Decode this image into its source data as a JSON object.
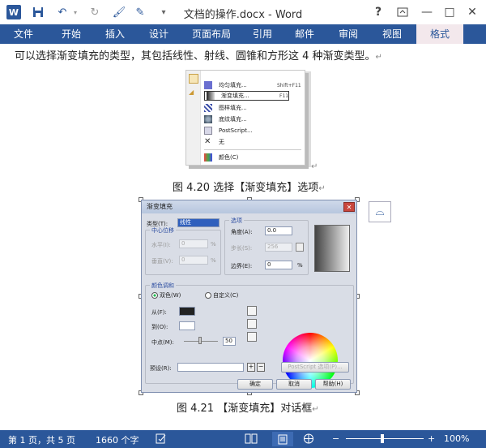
{
  "window": {
    "title": "文档的操作.docx - Word",
    "help": "?",
    "minimize": "—",
    "maximize": "□",
    "close": "✕"
  },
  "ribbon": {
    "tabs": [
      "文件",
      "开始",
      "插入",
      "设计",
      "页面布局",
      "引用",
      "邮件",
      "审阅",
      "视图",
      "格式"
    ]
  },
  "document": {
    "intro_text": "可以选择渐变填充的类型，其包括线性、射线、圆锥和方形这 4 种渐变类型。",
    "menu": {
      "items": [
        {
          "label": "均匀填充...",
          "shortcut": "Shift+F11"
        },
        {
          "label": "渐变填充...",
          "shortcut": "F11"
        },
        {
          "label": "图样填充...",
          "shortcut": ""
        },
        {
          "label": "底纹填充...",
          "shortcut": ""
        },
        {
          "label": "PostScript...",
          "shortcut": ""
        },
        {
          "label": "无",
          "shortcut": ""
        },
        {
          "label": "颜色(C)",
          "shortcut": ""
        }
      ]
    },
    "caption1": "图 4.20  选择【渐变填充】选项",
    "caption2": "图 4.21 【渐变填充】对话框",
    "para_mark": "↵"
  },
  "dialog": {
    "title": "渐变填充",
    "type_label": "类型(T):",
    "type_value": "线性",
    "center_offset": "中心位移",
    "horizontal": "水平(I):",
    "vertical": "垂直(V):",
    "zero": "0",
    "percent": "%",
    "options": "选项",
    "angle_label": "角度(A):",
    "angle_value": "0.0",
    "steps_label": "步长(S):",
    "steps_value": "256",
    "edge_label": "边界(E):",
    "edge_value": "0",
    "color_blend": "颜色调和",
    "two_color": "双色(W)",
    "custom": "自定义(C)",
    "from_label": "从(F):",
    "to_label": "到(O):",
    "midpoint_label": "中点(M):",
    "midpoint_value": "50",
    "preset_label": "预设(R):",
    "postscript_btn": "PostScript 选项(P)...",
    "ok": "确定",
    "cancel": "取消",
    "help": "帮助(H)"
  },
  "status": {
    "page": "第 1 页，共 5 页",
    "words": "1660 个字",
    "zoom": "100%"
  },
  "colors": {
    "accent": "#2b579a",
    "format_tab_bg": "#f3e8ec"
  }
}
